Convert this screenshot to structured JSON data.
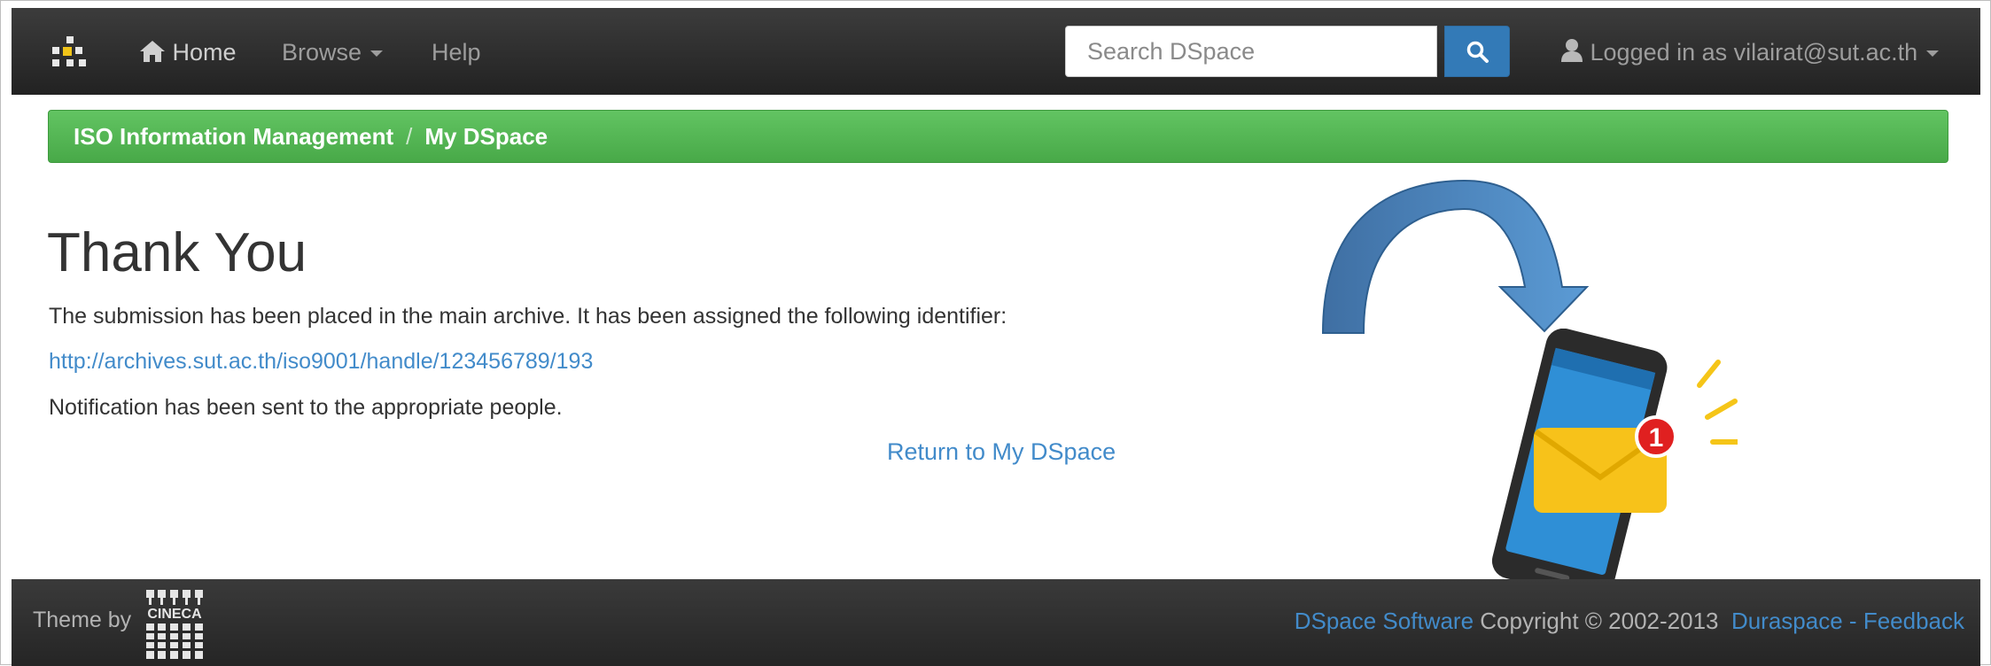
{
  "navbar": {
    "brand_icon": "dspace-logo-icon",
    "home_label": "Home",
    "browse_label": "Browse",
    "help_label": "Help",
    "search_placeholder": "Search DSpace",
    "user_label": "Logged in as vilairat@sut.ac.th"
  },
  "breadcrumb": {
    "items": [
      "ISO Information Management",
      "My DSpace"
    ],
    "separator": "/"
  },
  "main": {
    "title": "Thank You",
    "message": "The submission has been placed in the main archive. It has been assigned the following identifier:",
    "identifier": "http://archives.sut.ac.th/iso9001/handle/123456789/193",
    "notification": "Notification has been sent to the appropriate people.",
    "return_link": "Return to My DSpace"
  },
  "illustration": {
    "badge_count": "1"
  },
  "footer": {
    "theme_by": "Theme by",
    "logo_text": "CINECA",
    "dspace_software": "DSpace Software",
    "copyright": "Copyright © 2002-2013",
    "duraspace": "Duraspace",
    "dash": "-",
    "feedback": "Feedback"
  },
  "colors": {
    "navbar_bg": "#222222",
    "breadcrumb_bg": "#5cb85c",
    "link": "#428bca",
    "search_button": "#337ab7"
  }
}
